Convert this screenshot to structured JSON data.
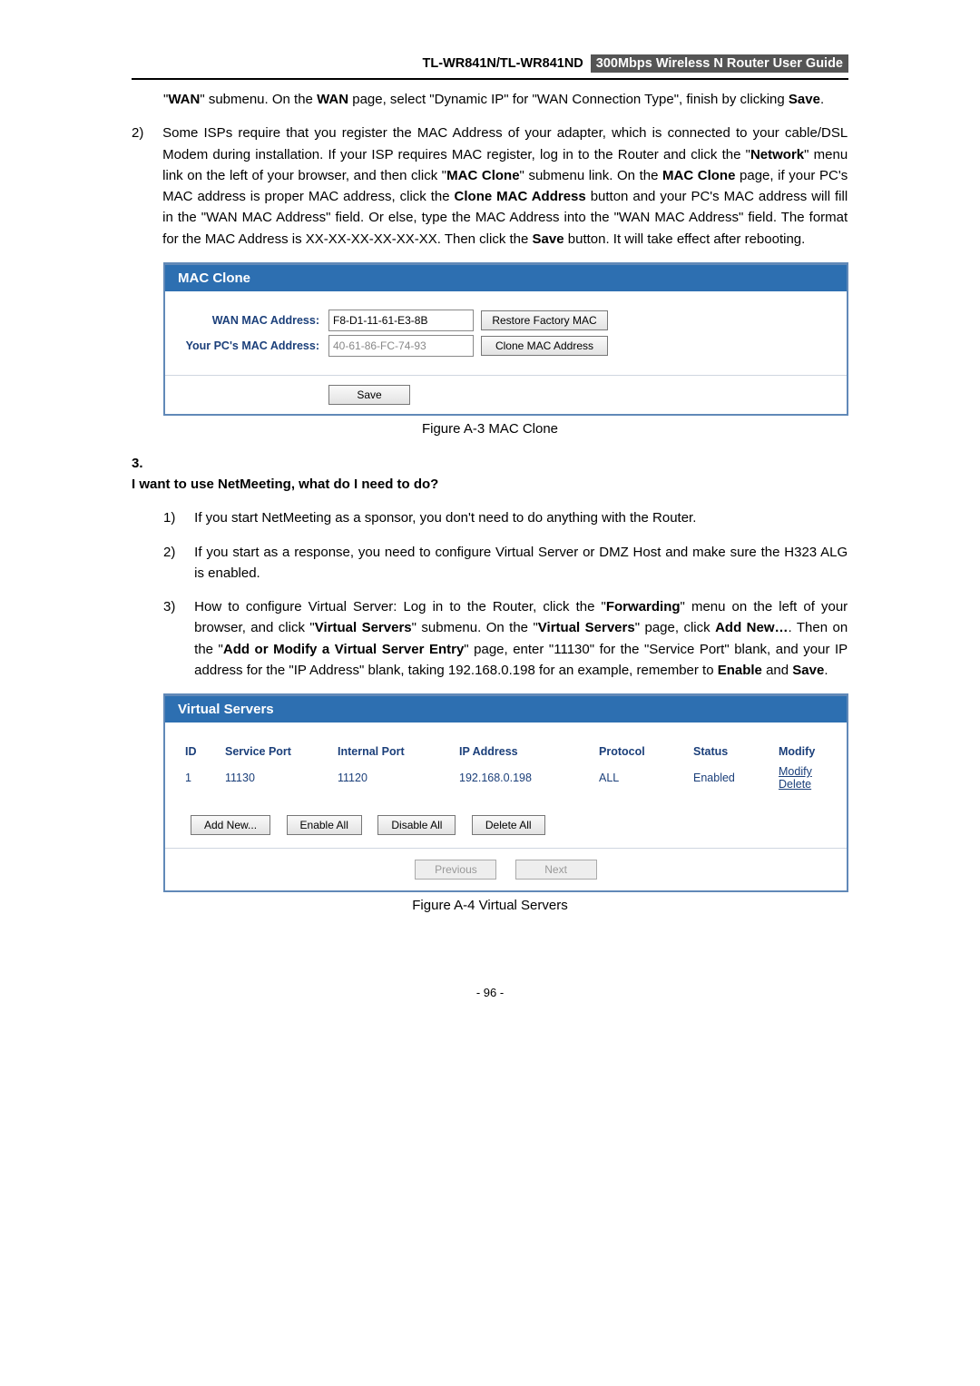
{
  "header": {
    "model": "TL-WR841N/TL-WR841ND",
    "guide": "300Mbps Wireless N Router User Guide"
  },
  "top": {
    "line1a": "\"",
    "b1": "WAN",
    "line1b": "\" submenu. On the ",
    "b2": "WAN",
    "line1c": " page, select \"Dynamic IP\" for \"WAN Connection Type\", finish by clicking ",
    "b3": "Save",
    "line1d": "."
  },
  "item2": {
    "num": "2)",
    "t1": "Some ISPs require that you register the MAC Address of your adapter, which is connected to your cable/DSL Modem during installation. If your ISP requires MAC register, log in to the Router and click the \"",
    "b1": "Network",
    "t2": "\" menu link on the left of your browser, and then click \"",
    "b2": "MAC Clone",
    "t3": "\" submenu link. On the ",
    "b3": "MAC Clone",
    "t4": " page, if your PC's MAC address is proper MAC address, click the ",
    "b4": "Clone MAC Address",
    "t5": " button and your PC's MAC address will fill in the \"WAN MAC Address\" field. Or else, type the MAC Address into the \"WAN MAC Address\" field. The format for the MAC Address is XX-XX-XX-XX-XX-XX. Then click the ",
    "b5": "Save",
    "t6": " button. It will take effect after rebooting."
  },
  "mac": {
    "title": "MAC Clone",
    "wan_lbl": "WAN MAC Address:",
    "wan_val": "F8-D1-11-61-E3-8B",
    "restore": "Restore Factory MAC",
    "pc_lbl": "Your PC's MAC Address:",
    "pc_val": "40-61-86-FC-74-93",
    "clone": "Clone MAC Address",
    "save": "Save"
  },
  "fig3": "Figure A-3    MAC Clone",
  "q3": {
    "num": "3.",
    "text": "I want to use NetMeeting, what do I need to do?"
  },
  "n1": {
    "num": "1)",
    "text": "If you start NetMeeting as a sponsor, you don't need to do anything with the Router."
  },
  "n2": {
    "num": "2)",
    "text": "If you start as a response, you need to configure Virtual Server or DMZ Host and make sure the H323 ALG is enabled."
  },
  "n3": {
    "num": "3)",
    "t1": "How to configure Virtual Server: Log in to the Router, click the \"",
    "b1": "Forwarding",
    "t2": "\" menu on the left of your browser, and click \"",
    "b2": "Virtual Servers",
    "t3": "\" submenu. On the \"",
    "b3": "Virtual Servers",
    "t4": "\" page, click ",
    "b4": "Add New…",
    "t5": ". Then on the \"",
    "b5": "Add or Modify a Virtual Server Entry",
    "t6": "\" page, enter \"11130\" for the \"Service Port\" blank, and your IP address for the \"IP Address\" blank, taking 192.168.0.198 for an example, remember to ",
    "b6": "Enable",
    "t7": " and ",
    "b7": "Save",
    "t8": "."
  },
  "vs": {
    "title": "Virtual Servers",
    "cols": {
      "id": "ID",
      "sp": "Service Port",
      "ip": "Internal Port",
      "ipaddr": "IP Address",
      "proto": "Protocol",
      "status": "Status",
      "mod": "Modify"
    },
    "row": {
      "id": "1",
      "sp": "11130",
      "ip": "11120",
      "ipaddr": "192.168.0.198",
      "proto": "ALL",
      "status": "Enabled",
      "m1": "Modify",
      "m2": "Delete"
    },
    "addnew": "Add New...",
    "enable": "Enable All",
    "disable": "Disable All",
    "delete": "Delete All",
    "prev": "Previous",
    "next": "Next"
  },
  "fig4": "Figure A-4    Virtual Servers",
  "pgnum": "- 96 -"
}
